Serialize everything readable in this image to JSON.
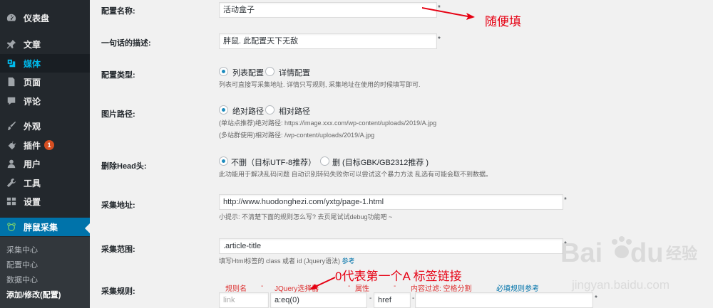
{
  "sidebar": {
    "items": [
      {
        "label": "仪表盘",
        "icon": "dashboard-icon"
      },
      {
        "label": "文章",
        "icon": "pin-icon"
      },
      {
        "label": "媒体",
        "icon": "media-icon"
      },
      {
        "label": "页面",
        "icon": "page-icon"
      },
      {
        "label": "评论",
        "icon": "comment-icon"
      },
      {
        "label": "外观",
        "icon": "brush-icon"
      },
      {
        "label": "插件",
        "icon": "plugin-icon",
        "badge": "1"
      },
      {
        "label": "用户",
        "icon": "user-icon"
      },
      {
        "label": "工具",
        "icon": "wrench-icon"
      },
      {
        "label": "设置",
        "icon": "settings-icon"
      },
      {
        "label": "胖鼠采集",
        "icon": "fatrat-icon"
      }
    ],
    "submenu": [
      "采集中心",
      "配置中心",
      "数据中心",
      "添加/修改(配置)"
    ]
  },
  "form": {
    "name": {
      "label": "配置名称:",
      "value": "活动盒子",
      "required": "*"
    },
    "desc": {
      "label": "一句话的描述:",
      "value": "胖鼠. 此配置天下无敌",
      "required": "*"
    },
    "type": {
      "label": "配置类型:",
      "opt1": "列表配置",
      "opt2": "详情配置",
      "help": "列表可直接写采集地址. 详情只写规则, 采集地址在使用的时候填写即可."
    },
    "img_path": {
      "label": "图片路径:",
      "opt1": "绝对路径",
      "opt2": "相对路径",
      "help1": "(单站点推荐)绝对路径: https://image.xxx.com/wp-content/uploads/2019/A.jpg",
      "help2": "(多站群使用)相对路径: /wp-content/uploads/2019/A.jpg"
    },
    "head": {
      "label": "删除Head头:",
      "opt1": "不删（目标UTF-8推荐）",
      "opt2": "删 (目标GBK/GB2312推荐 )",
      "help": "此功能用于解决乱码问题 自动识别转码失败你可以尝试这个暴力方法 乱选有可能会取不到数据。"
    },
    "url": {
      "label": "采集地址:",
      "value": "http://www.huodonghezi.com/yxtg/page-1.html",
      "required": "*",
      "help": "小提示: 不清楚下面的规则怎么写? 去页尾试试debug功能吧 ~"
    },
    "range": {
      "label": "采集范围:",
      "value": ".article-title",
      "required": "*",
      "help": "填写Html标签的 class 或者 id (Jquery语法)",
      "help_link": "参考"
    },
    "rules": {
      "label": "采集规则:",
      "headers": {
        "name": "规则名",
        "dash1": "-",
        "jquery": "JQuery选择器",
        "dash2": "-",
        "attr": "属性",
        "dash3": "-",
        "filter": "内容过滤: 空格分割",
        "ref": "必填规则参考"
      },
      "row": {
        "name_placeholder": "link",
        "selector": "a:eq(0)",
        "dash1": "-",
        "dash2": "-",
        "attr": "href",
        "filter": "",
        "required": "*"
      }
    }
  },
  "annotations": {
    "fill_any": "随便填",
    "link_note": "0代表第一个A 标签链接"
  },
  "watermark": {
    "brand1": "Bai",
    "brand2": "du",
    "cn": "经验",
    "url": "jingyan.baidu.com"
  },
  "colors": {
    "accent": "#0073aa",
    "annotation": "#e60012",
    "sidebar": "#23282d"
  }
}
